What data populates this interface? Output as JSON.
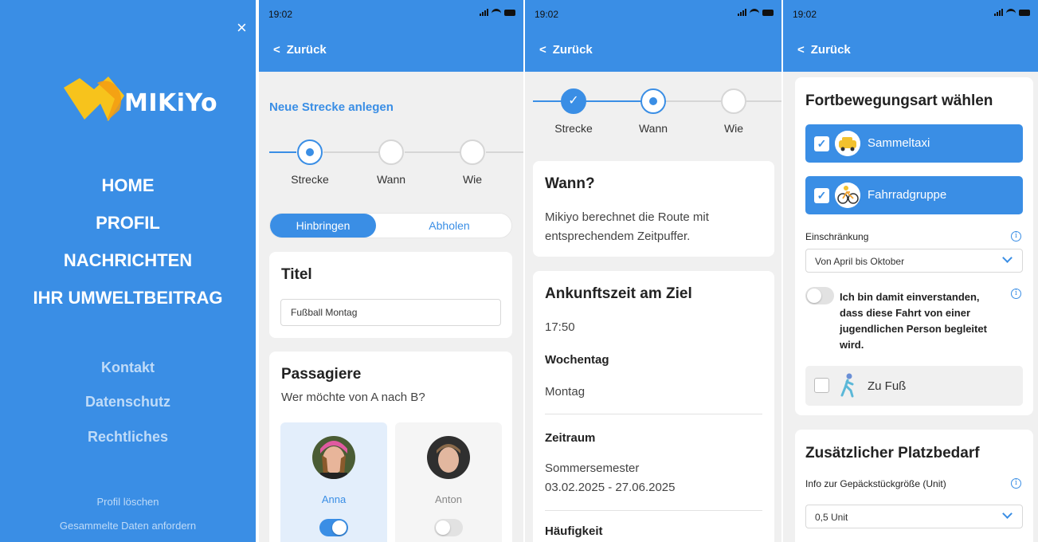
{
  "menu": {
    "close_label": "×",
    "brand": "MIKiYo",
    "main_items": [
      "HOME",
      "PROFIL",
      "NACHRICHTEN",
      "IHR UMWELTBEITRAG"
    ],
    "sub_items": [
      "Kontakt",
      "Datenschutz",
      "Rechtliches"
    ],
    "footer_items": [
      "Profil löschen",
      "Gesammelte Daten anfordern"
    ]
  },
  "status": {
    "time": "19:02"
  },
  "nav": {
    "back_label": "Zurück"
  },
  "stepper": {
    "labels": [
      "Strecke",
      "Wann",
      "Wie"
    ]
  },
  "screen_route": {
    "heading": "Neue Strecke anlegen",
    "segment": {
      "left": "Hinbringen",
      "right": "Abholen",
      "selected": "Hinbringen"
    },
    "title_card": {
      "label": "Titel",
      "value": "Fußball Montag"
    },
    "passengers_card": {
      "label": "Passagiere",
      "question": "Wer möchte von A nach B?",
      "people": [
        {
          "name": "Anna",
          "selected": true
        },
        {
          "name": "Anton",
          "selected": false
        }
      ]
    }
  },
  "screen_when": {
    "card1": {
      "title": "Wann?",
      "text": "Mikiyo berechnet die Route mit entsprechendem Zeitpuffer."
    },
    "card2": {
      "title": "Ankunftszeit am Ziel",
      "arrival_time": "17:50",
      "weekday_label": "Wochentag",
      "weekday_value": "Montag",
      "period_label": "Zeitraum",
      "period_name": "Sommersemester",
      "period_dates": "03.02.2025 - 27.06.2025",
      "frequency_label": "Häufigkeit"
    }
  },
  "screen_how": {
    "card1": {
      "title": "Fortbewegungsart wählen",
      "options": [
        {
          "label": "Sammeltaxi",
          "checked": true,
          "icon": "taxi-icon"
        },
        {
          "label": "Fahrradgruppe",
          "checked": true,
          "icon": "bicycle-icon"
        }
      ],
      "restriction_label": "Einschränkung",
      "restriction_value": "Von April bis Oktober",
      "consent_text": "Ich bin damit einverstanden, dass diese Fahrt von einer jugendlichen Person begleitet wird.",
      "consent_checked": false,
      "walk": {
        "label": "Zu Fuß",
        "checked": false,
        "icon": "walking-person-icon"
      }
    },
    "card2": {
      "title": "Zusätzlicher Platzbedarf",
      "luggage_label": "Info zur Gepäckstückgröße (Unit)",
      "luggage_value": "0,5 Unit"
    }
  },
  "colors": {
    "primary": "#3a8ee5",
    "background": "#f0f0f0",
    "muted_menu": "#bfdbf8"
  }
}
